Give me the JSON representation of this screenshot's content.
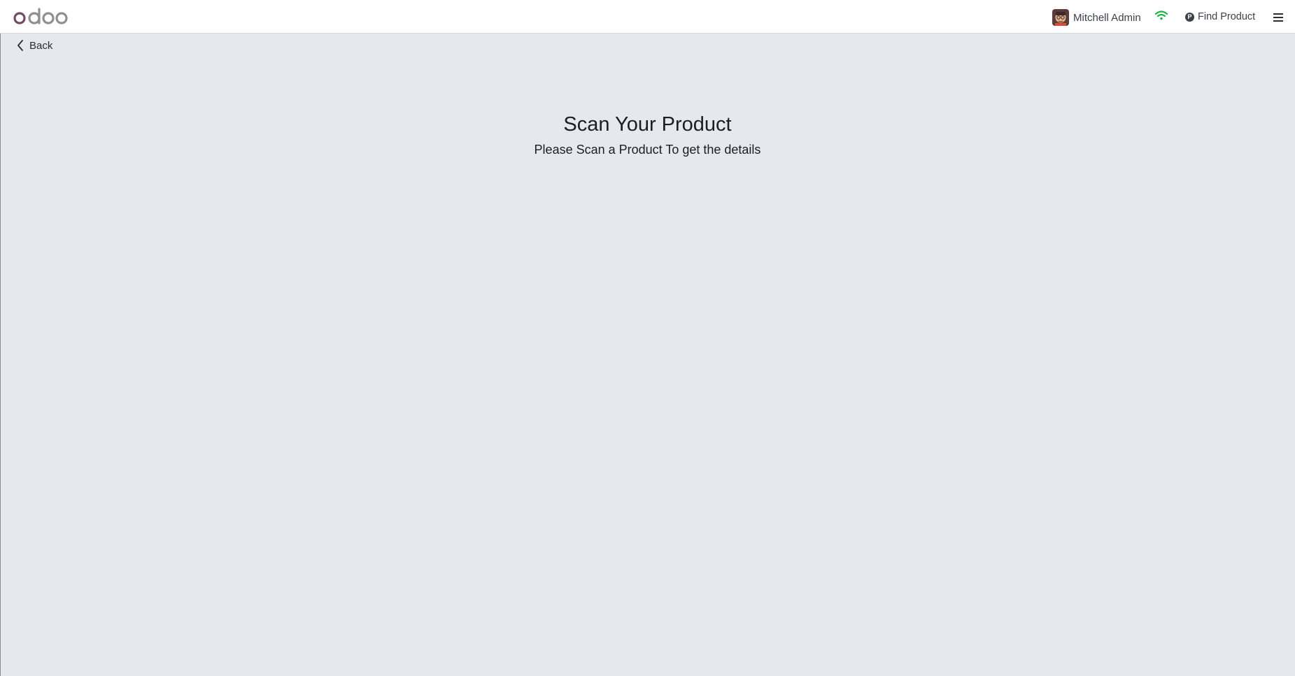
{
  "header": {
    "logo_text": "odoo",
    "user": {
      "name": "Mitchell Admin",
      "avatar_icon": "user-avatar-icon"
    },
    "connection_icon": "wifi-icon",
    "connection_color": "#1bb34a",
    "find_product": {
      "label": "Find Product",
      "icon": "p-circle-icon"
    },
    "menu_icon": "hamburger-menu-icon"
  },
  "nav": {
    "back_label": "Back"
  },
  "main": {
    "title": "Scan Your Product",
    "subtitle": "Please Scan a Product To get the details"
  },
  "colors": {
    "brand_primary": "#714b67",
    "brand_secondary": "#8f8f8f",
    "background": "#e7e8ed"
  }
}
